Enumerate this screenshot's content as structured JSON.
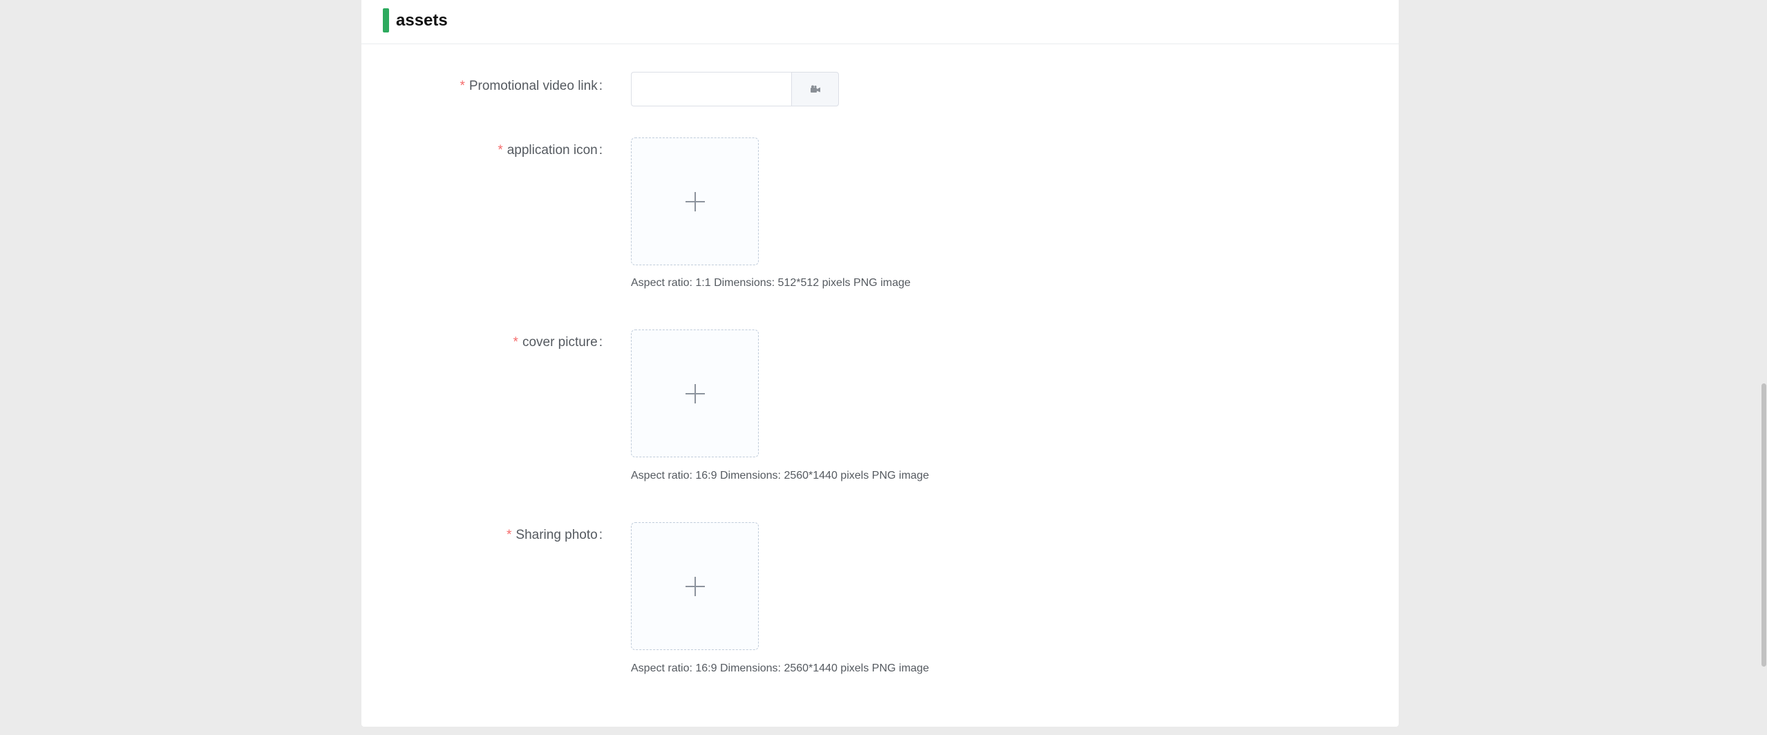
{
  "section": {
    "title": "assets",
    "accent_color": "#2daa5e"
  },
  "form": {
    "required_mark": "*",
    "colon": ":",
    "video": {
      "label": "Promotional video link",
      "value": "",
      "placeholder": "",
      "append_icon": "video-camera-icon"
    },
    "app_icon": {
      "label": "application icon",
      "upload_icon": "plus-icon",
      "hint": "Aspect ratio: 1:1 Dimensions: 512*512 pixels PNG image"
    },
    "cover": {
      "label": "cover picture",
      "upload_icon": "plus-icon",
      "hint": "Aspect ratio: 16:9 Dimensions: 2560*1440 pixels PNG image"
    },
    "sharing": {
      "label": "Sharing photo",
      "upload_icon": "plus-icon",
      "hint": "Aspect ratio: 16:9 Dimensions: 2560*1440 pixels PNG image"
    }
  },
  "colors": {
    "background": "#ebebeb",
    "card": "#ffffff",
    "required": "#f56c6c",
    "label_text": "#555a60"
  }
}
